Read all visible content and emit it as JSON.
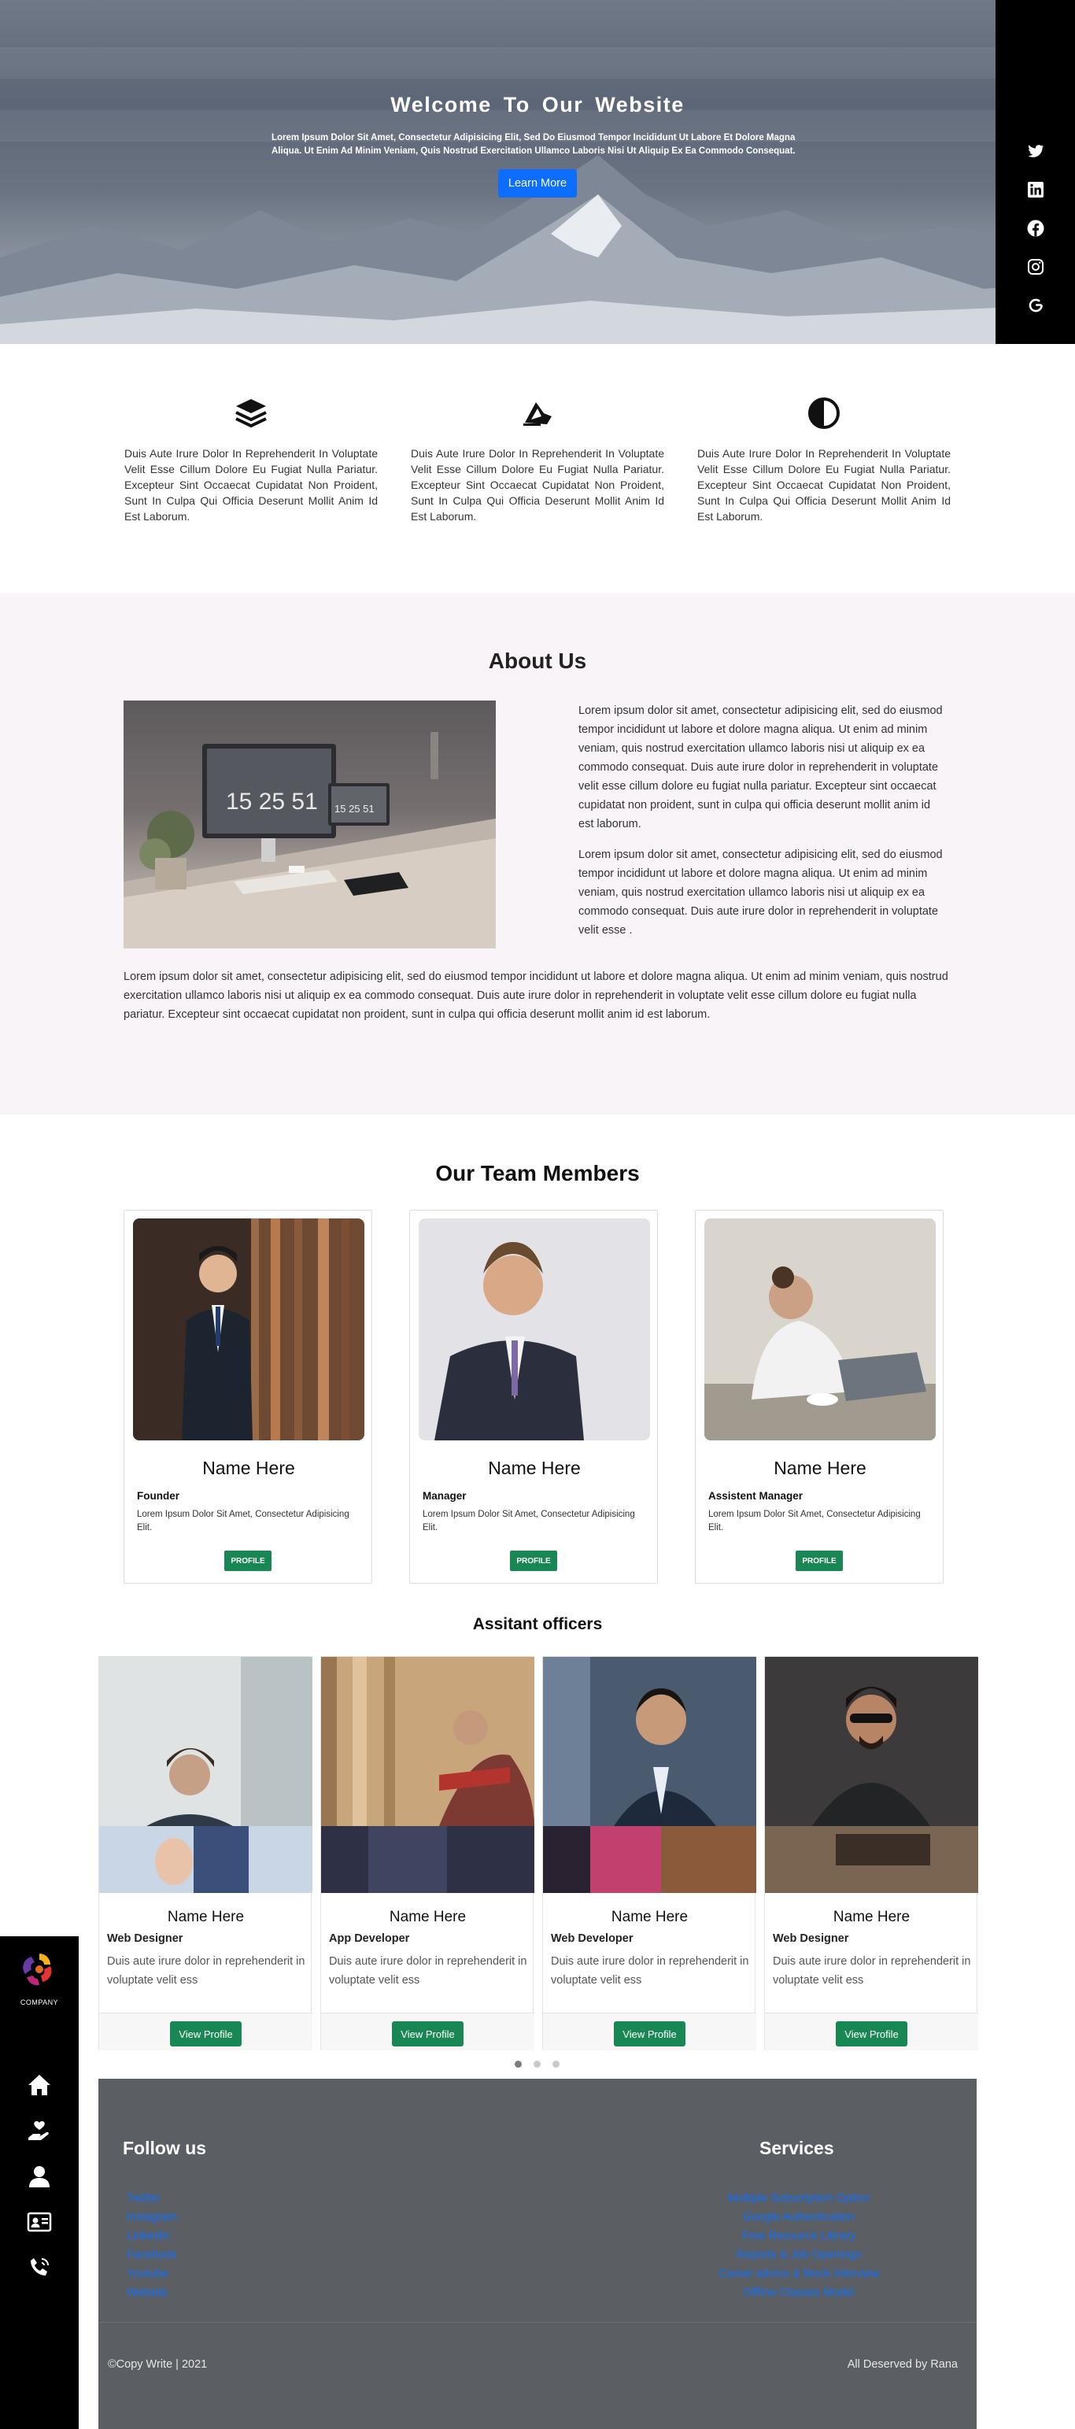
{
  "hero": {
    "title": "Welcome To Our Website",
    "text": "Lorem Ipsum Dolor Sit Amet, Consectetur Adipisicing Elit, Sed Do Eiusmod Tempor Incididunt Ut Labore Et Dolore Magna Aliqua. Ut Enim Ad Minim Veniam, Quis Nostrud Exercitation Ullamco Laboris Nisi Ut Aliquip Ex Ea Commodo Consequat.",
    "button": "Learn More"
  },
  "social": {
    "icons": [
      "twitter-icon",
      "linkedin-icon",
      "facebook-icon",
      "instagram-icon",
      "google-icon"
    ]
  },
  "features": {
    "items": [
      {
        "icon": "layers-icon",
        "text": "Duis Aute Irure Dolor In Reprehenderit In Voluptate Velit Esse Cillum Dolore Eu Fugiat Nulla Pariatur. Excepteur Sint Occaecat Cupidatat Non Proident, Sunt In Culpa Qui Officia Deserunt Mollit Anim Id Est Laborum."
      },
      {
        "icon": "vector-pen-icon",
        "text": "Duis Aute Irure Dolor In Reprehenderit In Voluptate Velit Esse Cillum Dolore Eu Fugiat Nulla Pariatur. Excepteur Sint Occaecat Cupidatat Non Proident, Sunt In Culpa Qui Officia Deserunt Mollit Anim Id Est Laborum."
      },
      {
        "icon": "contrast-icon",
        "text": "Duis Aute Irure Dolor In Reprehenderit In Voluptate Velit Esse Cillum Dolore Eu Fugiat Nulla Pariatur. Excepteur Sint Occaecat Cupidatat Non Proident, Sunt In Culpa Qui Officia Deserunt Mollit Anim Id Est Laborum."
      }
    ]
  },
  "about": {
    "title": "About Us",
    "image_clock": "15 25 51",
    "image_clock_small": "15 25 51",
    "p1": "Lorem ipsum dolor sit amet, consectetur adipisicing elit, sed do eiusmod tempor incididunt ut labore et dolore magna aliqua. Ut enim ad minim veniam, quis nostrud exercitation ullamco laboris nisi ut aliquip ex ea commodo consequat. Duis aute irure dolor in reprehenderit in voluptate velit esse cillum dolore eu fugiat nulla pariatur. Excepteur sint occaecat cupidatat non proident, sunt in culpa qui officia deserunt mollit anim id est laborum.",
    "p2": "Lorem ipsum dolor sit amet, consectetur adipisicing elit, sed do eiusmod tempor incididunt ut labore et dolore magna aliqua. Ut enim ad minim veniam, quis nostrud exercitation ullamco laboris nisi ut aliquip ex ea commodo consequat. Duis aute irure dolor in reprehenderit in voluptate velit esse .",
    "p3": "Lorem ipsum dolor sit amet, consectetur adipisicing elit, sed do eiusmod tempor incididunt ut labore et dolore magna aliqua. Ut enim ad minim veniam, quis nostrud exercitation ullamco laboris nisi ut aliquip ex ea commodo consequat. Duis aute irure dolor in reprehenderit in voluptate velit esse cillum dolore eu fugiat nulla pariatur. Excepteur sint occaecat cupidatat non proident, sunt in culpa qui officia deserunt mollit anim id est laborum."
  },
  "team": {
    "title": "Our Team Members",
    "members": [
      {
        "name": "Name Here",
        "role": "Founder",
        "desc": "Lorem Ipsum Dolor Sit Amet, Consectetur Adipisicing Elit.",
        "button": "PROFILE"
      },
      {
        "name": "Name Here",
        "role": "Manager",
        "desc": "Lorem Ipsum Dolor Sit Amet, Consectetur Adipisicing Elit.",
        "button": "PROFILE"
      },
      {
        "name": "Name Here",
        "role": "Assistent Manager",
        "desc": "Lorem Ipsum Dolor Sit Amet, Consectetur Adipisicing Elit.",
        "button": "PROFILE"
      }
    ]
  },
  "officers": {
    "title": "Assitant officers",
    "items": [
      {
        "name": "Name Here",
        "role": "Web Designer",
        "desc": "Duis aute irure dolor in reprehenderit in voluptate velit ess",
        "button": "View Profile"
      },
      {
        "name": "Name Here",
        "role": "App Developer",
        "desc": "Duis aute irure dolor in reprehenderit in voluptate velit ess",
        "button": "View Profile"
      },
      {
        "name": "Name Here",
        "role": "Web Developer",
        "desc": "Duis aute irure dolor in reprehenderit in voluptate velit ess",
        "button": "View Profile"
      },
      {
        "name": "Name Here",
        "role": "Web Designer",
        "desc": "Duis aute irure dolor in reprehenderit in voluptate velit ess",
        "button": "View Profile"
      }
    ],
    "active_dot": 0
  },
  "left_nav": {
    "logo_label": "COMPANY",
    "icons": [
      "home-icon",
      "hand-heart-icon",
      "person-icon",
      "contact-card-icon",
      "phone-icon"
    ]
  },
  "footer": {
    "follow_title": "Follow us",
    "follow_links": [
      "Twitter",
      "Instagram",
      "Linkedin",
      "Facebook",
      "Youtube",
      "Website"
    ],
    "services_title": "Services",
    "services_links": [
      "Multiple Subscription Option",
      "Google Authentication",
      "Free Resource Library",
      "Reports & Job Openings",
      "Career advice & Mock Interview",
      "Offline Classes Model"
    ],
    "copyright": "©Copy Write | 2021",
    "rights": "All Deserved by Rana"
  },
  "colors": {
    "accent": "#0d6efd",
    "success": "#198754",
    "footer_bg": "#5b5f63",
    "about_bg": "#f9f4f7"
  }
}
